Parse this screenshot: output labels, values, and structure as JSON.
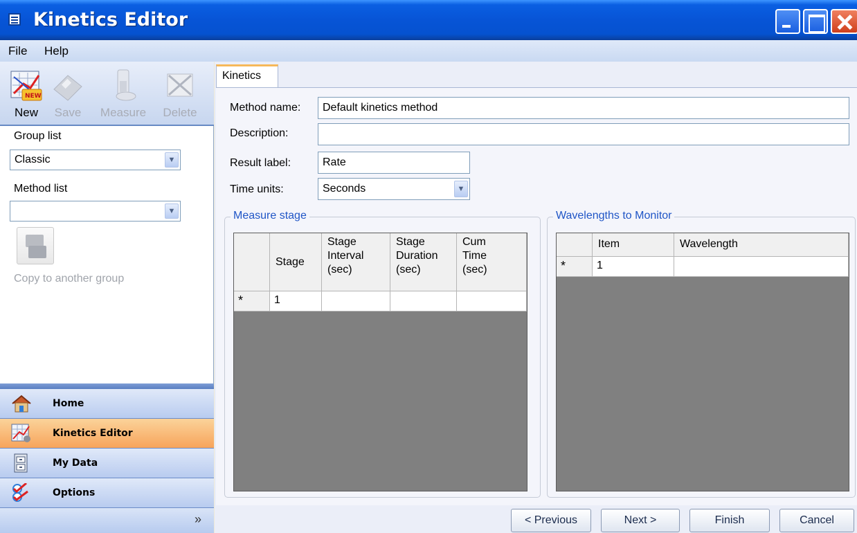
{
  "window": {
    "title": "Kinetics Editor"
  },
  "menu": {
    "file": "File",
    "help": "Help"
  },
  "toolbar": {
    "new": "New",
    "save": "Save",
    "measure": "Measure",
    "delete": "Delete"
  },
  "left": {
    "group_list_label": "Group list",
    "group_list_value": "Classic",
    "method_list_label": "Method list",
    "method_list_value": "",
    "copy_label": "Copy to another group"
  },
  "nav": {
    "items": [
      {
        "label": "Home",
        "icon": "house-icon"
      },
      {
        "label": "Kinetics Editor",
        "icon": "kinetics-chart-icon",
        "selected": true
      },
      {
        "label": "My Data",
        "icon": "cabinet-icon"
      },
      {
        "label": "Options",
        "icon": "checklist-icon"
      }
    ],
    "expand_glyph": "»"
  },
  "tab": {
    "label": "Kinetics"
  },
  "form": {
    "method_name_label": "Method name:",
    "method_name_value": "Default kinetics method",
    "description_label": "Description:",
    "description_value": "",
    "result_label_label": "Result label:",
    "result_label_value": "Rate",
    "time_units_label": "Time units:",
    "time_units_value": "Seconds"
  },
  "measure_stage": {
    "title": "Measure stage",
    "columns": [
      "Stage",
      "Stage Interval (sec)",
      "Stage Duration (sec)",
      "Cum Time (sec)"
    ],
    "new_row_marker": "*",
    "rows": [
      [
        "1",
        "",
        "",
        ""
      ]
    ]
  },
  "wavelengths": {
    "title": "Wavelengths to Monitor",
    "columns": [
      "Item",
      "Wavelength"
    ],
    "new_row_marker": "*",
    "rows": [
      [
        "1",
        ""
      ]
    ]
  },
  "buttons": {
    "previous": "< Previous",
    "next": "Next >",
    "finish": "Finish",
    "cancel": "Cancel"
  },
  "colors": {
    "title_bar": "#0754d6",
    "selected_nav": "#f7a45b",
    "group_title": "#1f55c6",
    "grid_bg": "#808080"
  }
}
